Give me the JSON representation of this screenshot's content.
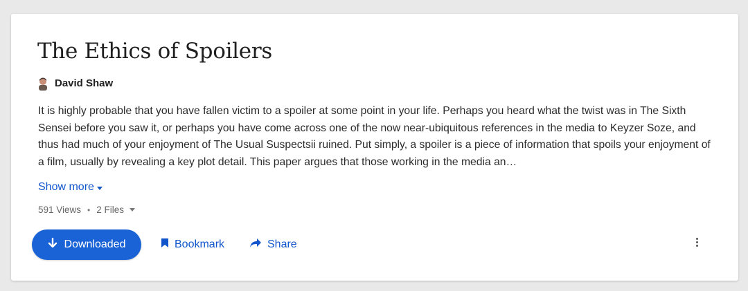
{
  "paper": {
    "title": "The Ethics of Spoilers",
    "author": "David Shaw",
    "abstract": "It is highly probable that you have fallen victim to a spoiler at some point in your life. Perhaps you heard what the twist was in The Sixth Sensei before you saw it, or perhaps you have come across one of the now near-ubiquitous references in the media to Keyzer Soze, and thus had much of your enjoyment of The Usual Suspectsii ruined. Put simply, a spoiler is a piece of information that spoils your enjoyment of a film, usually by revealing a key plot detail. This paper argues that those working in the media an…",
    "show_more_label": "Show more"
  },
  "meta": {
    "views": "591 Views",
    "separator": "•",
    "files": "2 Files"
  },
  "actions": {
    "download_label": "Downloaded",
    "bookmark_label": "Bookmark",
    "share_label": "Share"
  },
  "icons": {
    "author": "person-avatar-icon",
    "download": "arrow-down-icon",
    "bookmark": "bookmark-icon",
    "share": "share-arrow-icon",
    "more": "more-vertical-icon"
  },
  "colors": {
    "accent": "#1a63d6",
    "link": "#1155cc"
  }
}
